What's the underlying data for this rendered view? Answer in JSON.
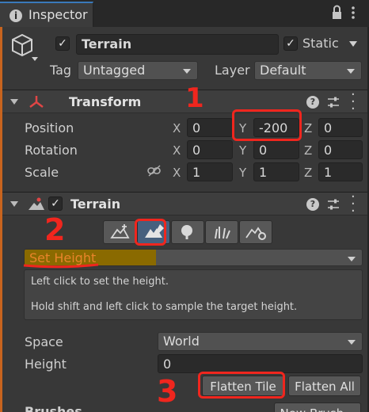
{
  "tab": {
    "title": "Inspector"
  },
  "object": {
    "name": "Terrain",
    "static_label": "Static",
    "active": true,
    "static": true
  },
  "tag": {
    "label": "Tag",
    "value": "Untagged"
  },
  "layer": {
    "label": "Layer",
    "value": "Default"
  },
  "transform": {
    "title": "Transform",
    "position": {
      "label": "Position",
      "x": "0",
      "y": "-200",
      "z": "0"
    },
    "rotation": {
      "label": "Rotation",
      "x": "0",
      "y": "0",
      "z": "0"
    },
    "scale": {
      "label": "Scale",
      "x": "1",
      "y": "1",
      "z": "1"
    },
    "axis": {
      "x": "X",
      "y": "Y",
      "z": "Z"
    }
  },
  "terrain": {
    "title": "Terrain",
    "tool_dropdown": "Set Height",
    "help_line1": "Left click to set the height.",
    "help_line2": "Hold shift and left click to sample the target height.",
    "space": {
      "label": "Space",
      "value": "World"
    },
    "height": {
      "label": "Height",
      "value": "0"
    },
    "flatten_tile": "Flatten Tile",
    "flatten_all": "Flatten All",
    "brushes_label": "Brushes",
    "new_brush": "New Brush..."
  },
  "annotations": {
    "one": "1",
    "two": "2",
    "three": "3"
  },
  "colors": {
    "accent": "#3a79bb",
    "annotation": "#f0261e",
    "highlight": "#8a6a00"
  }
}
